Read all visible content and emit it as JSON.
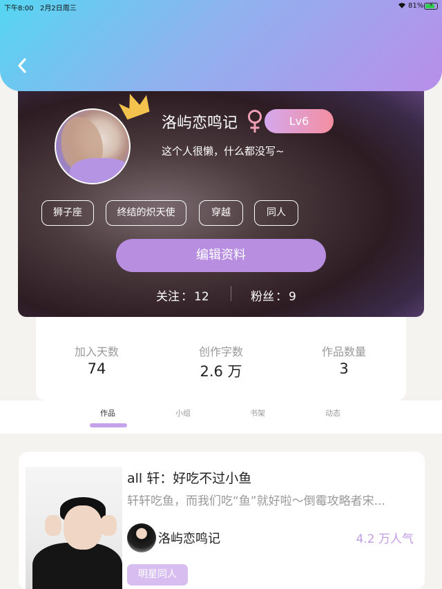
{
  "status_bar": {
    "time": "下午8:00",
    "date": "2月2日周三",
    "battery_percent": "81%",
    "battery_level": 0.81,
    "battery_charging": true
  },
  "header": {
    "gradient_colors": [
      "#55d6f2",
      "#b98eea"
    ],
    "back_icon": "chevron-left-icon"
  },
  "profile": {
    "username": "洛屿恋鸣记",
    "gender_icon": "female-symbol-icon",
    "gender_color": "#f3a0b6",
    "level": "Lv6",
    "bio": "这个人很懒，什么都没写~",
    "tags": [
      "狮子座",
      "终结的炽天使",
      "穿越",
      "同人"
    ],
    "edit_button_label": "编辑资料",
    "following_label": "关注",
    "following_count": "12",
    "followers_label": "粉丝",
    "followers_count": "9",
    "separator": "："
  },
  "stats": [
    {
      "label": "加入天数",
      "value": "74"
    },
    {
      "label": "创作字数",
      "value": "2.6 万"
    },
    {
      "label": "作品数量",
      "value": "3"
    }
  ],
  "tabs": [
    {
      "label": "作品",
      "active": true
    },
    {
      "label": "小组",
      "active": false
    },
    {
      "label": "书架",
      "active": false
    },
    {
      "label": "动态",
      "active": false
    }
  ],
  "works": [
    {
      "title": "all 轩：好吃不过小鱼",
      "description": "轩轩吃鱼，而我们吃“鱼”就好啦～倒霉攻略者宋...",
      "author": "洛屿恋鸣记",
      "popularity": "4.2 万人气",
      "category": "明星同人"
    }
  ],
  "accent_color": "#b78ee0"
}
